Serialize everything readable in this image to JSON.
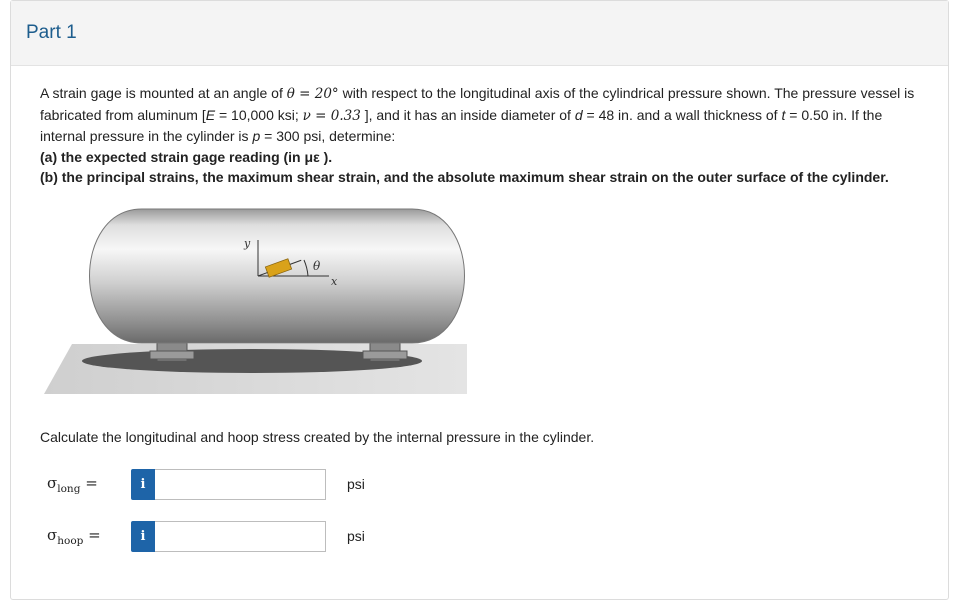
{
  "part": {
    "title": "Part 1"
  },
  "problem": {
    "s1": "A strain gage is mounted at an angle of ",
    "theta_eq": "θ = 20°",
    "s2": " with respect to the longitudinal axis of the cylindrical pressure shown. The pressure vessel is fabricated from aluminum [",
    "E_eq": "E",
    "s3": " = 10,000 ksi; ",
    "nu_eq": "ν = 0.33",
    "s4": " ], and it has an inside diameter of ",
    "d_eq": "d",
    "s5": " = 48 in. and a wall thickness of ",
    "t_eq": "t",
    "s6": " = 0.50 in. If the internal pressure in the cylinder is ",
    "p_eq": "p",
    "s7": " = 300 psi, determine:",
    "part_a": "(a) the expected strain gage reading (in με ).",
    "part_b": "(b) the principal strains, the maximum shear strain, and the absolute maximum shear strain on the outer surface of the cylinder."
  },
  "figure": {
    "y_label": "y",
    "x_label": "x",
    "theta_label": "θ",
    "colors": {
      "tank": "#c9c9c9",
      "ground": "#d8d8d8",
      "shadow": "#555555",
      "gage": "#d9a21a"
    }
  },
  "instruction": "Calculate the longitudinal and hoop stress created by the internal pressure in the cylinder.",
  "answers": [
    {
      "symbol": "σ",
      "subscript": "long",
      "eq": " =",
      "info": "i",
      "value": "",
      "unit": "psi"
    },
    {
      "symbol": "σ",
      "subscript": "hoop",
      "eq": " =",
      "info": "i",
      "value": "",
      "unit": "psi"
    }
  ]
}
